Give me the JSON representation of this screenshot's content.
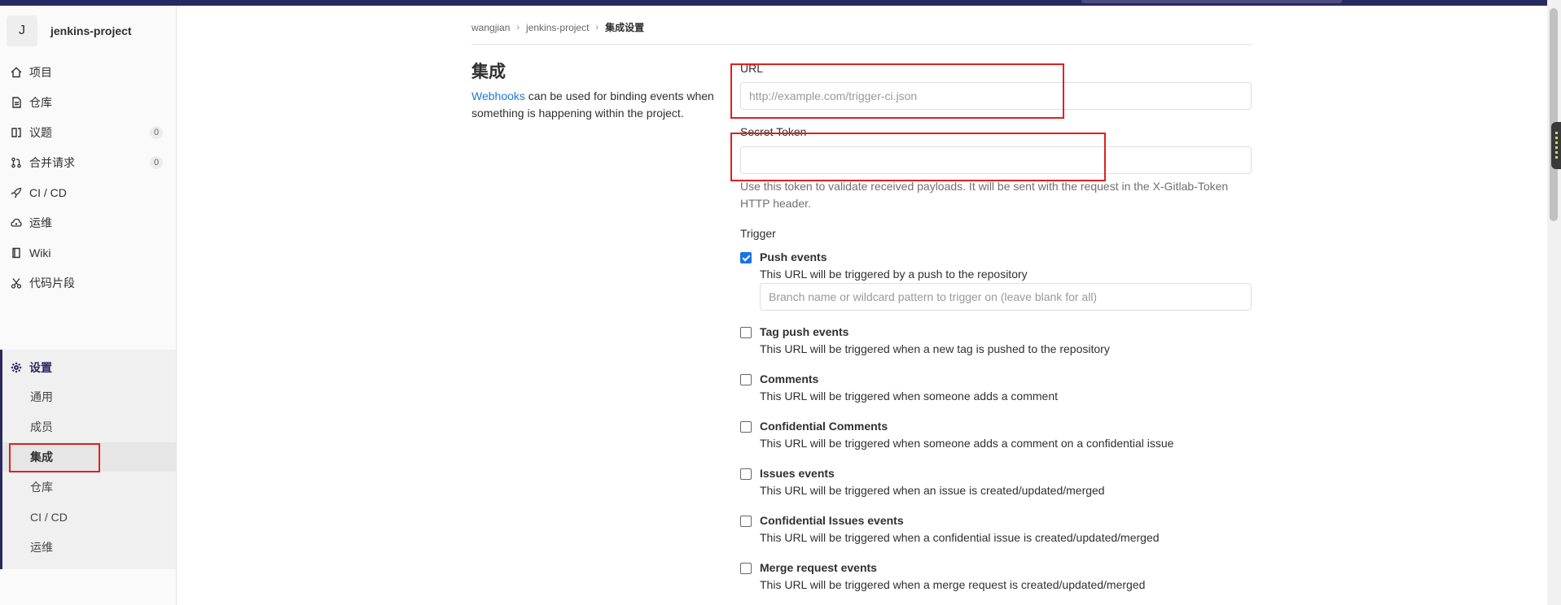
{
  "project": {
    "avatar_letter": "J",
    "name": "jenkins-project"
  },
  "sidebar": {
    "items": [
      {
        "label": "项目",
        "icon": "home-icon"
      },
      {
        "label": "仓库",
        "icon": "file-icon"
      },
      {
        "label": "议题",
        "icon": "issues-icon",
        "count": "0"
      },
      {
        "label": "合并请求",
        "icon": "merge-request-icon",
        "count": "0"
      },
      {
        "label": "CI / CD",
        "icon": "rocket-icon"
      },
      {
        "label": "运维",
        "icon": "cloud-icon"
      },
      {
        "label": "Wiki",
        "icon": "book-icon"
      },
      {
        "label": "代码片段",
        "icon": "scissors-icon"
      }
    ],
    "settings": {
      "label": "设置",
      "icon": "gear-icon",
      "subitems": [
        "通用",
        "成员",
        "集成",
        "仓库",
        "CI / CD",
        "运维"
      ],
      "selected": "集成"
    }
  },
  "breadcrumb": [
    "wangjian",
    "jenkins-project",
    "集成设置"
  ],
  "integrations": {
    "title": "集成",
    "description_link": "Webhooks",
    "description_text": " can be used for binding events when something is happening within the project."
  },
  "form": {
    "url_label": "URL",
    "url_placeholder": "http://example.com/trigger-ci.json",
    "url_value": "",
    "token_label": "Secret Token",
    "token_value": "",
    "token_help": "Use this token to validate received payloads. It will be sent with the request in the X-Gitlab-Token HTTP header.",
    "trigger_label": "Trigger",
    "branch_placeholder": "Branch name or wildcard pattern to trigger on (leave blank for all)",
    "triggers": [
      {
        "title": "Push events",
        "desc": "This URL will be triggered by a push to the repository",
        "checked": true
      },
      {
        "title": "Tag push events",
        "desc": "This URL will be triggered when a new tag is pushed to the repository",
        "checked": false
      },
      {
        "title": "Comments",
        "desc": "This URL will be triggered when someone adds a comment",
        "checked": false
      },
      {
        "title": "Confidential Comments",
        "desc": "This URL will be triggered when someone adds a comment on a confidential issue",
        "checked": false
      },
      {
        "title": "Issues events",
        "desc": "This URL will be triggered when an issue is created/updated/merged",
        "checked": false
      },
      {
        "title": "Confidential Issues events",
        "desc": "This URL will be triggered when a confidential issue is created/updated/merged",
        "checked": false
      },
      {
        "title": "Merge request events",
        "desc": "This URL will be triggered when a merge request is created/updated/merged",
        "checked": false
      }
    ]
  },
  "colors": {
    "accent": "#292961",
    "link": "#1f78d1",
    "highlight": "#e02020",
    "checkbox": "#1a73e8"
  }
}
